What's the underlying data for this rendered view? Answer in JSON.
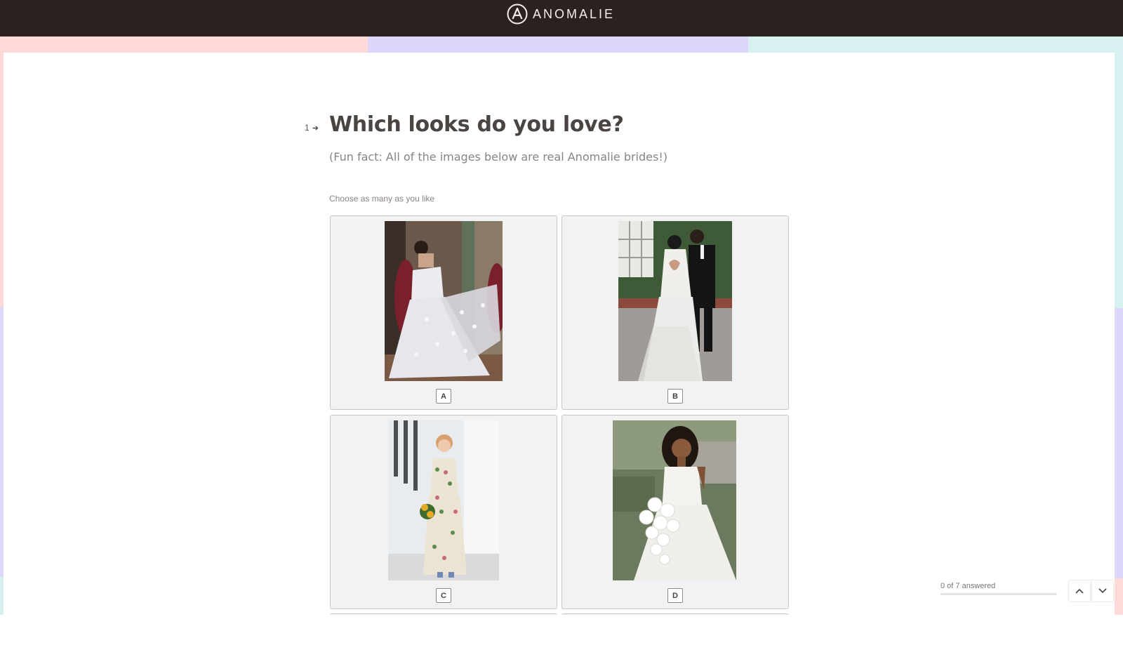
{
  "header": {
    "brand": "ANOMALIE",
    "logo_icon": "anomalie-a-logo-icon",
    "background": "#2b2220"
  },
  "frame_colors": {
    "pink": "#fddad8",
    "lavender": "#ddd8fa",
    "mint": "#d6f1ef"
  },
  "question": {
    "number": "1",
    "arrow_icon": "arrow-right-icon",
    "title": "Which looks do you love?",
    "subtitle": "(Fun fact: All of the images below are real Anomalie brides!)",
    "hint": "Choose as many as you like"
  },
  "choices": [
    {
      "key": "A",
      "image": "bride in off-shoulder tulle ball gown with long train, bridesmaids in red"
    },
    {
      "key": "B",
      "image": "bride in open-back gown with groom in black tuxedo"
    },
    {
      "key": "C",
      "image": "bride in floral embroidered gown holding sunflower bouquet"
    },
    {
      "key": "D",
      "image": "bride in satin gown holding white orchid bouquet"
    }
  ],
  "progress": {
    "label": "0 of 7 answered",
    "answered": 0,
    "total": 7
  },
  "nav": {
    "up_icon": "chevron-up-icon",
    "down_icon": "chevron-down-icon"
  }
}
